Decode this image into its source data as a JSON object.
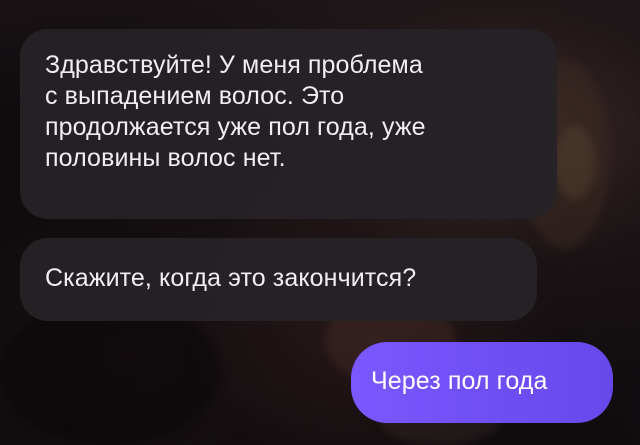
{
  "chat": {
    "messages": [
      {
        "sender": "user",
        "lines": [
          "Здравствуйте! У меня проблема",
          "с выпадением волос. Это",
          "продолжается уже пол года, уже",
          "половины волос нет."
        ]
      },
      {
        "sender": "user",
        "text": "Скажите, когда это закончится?"
      },
      {
        "sender": "assistant",
        "text": "Через пол года"
      }
    ]
  },
  "colors": {
    "incoming_bubble": "#252226",
    "outgoing_bubble": "#7256fb",
    "text": "#f1eef1",
    "background": "#151013"
  }
}
